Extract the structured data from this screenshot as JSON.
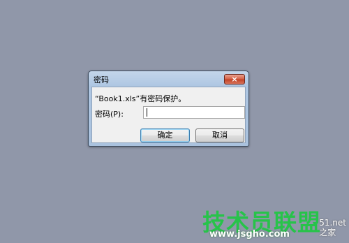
{
  "dialog": {
    "title": "密码",
    "close_symbol": "×",
    "message": "“Book1.xls”有密码保护。",
    "password_label": "密码(P):",
    "password_value": "",
    "ok_label": "确定",
    "cancel_label": "取消"
  },
  "watermark": {
    "brand": "技术员联盟",
    "url": "www.jsgho.com",
    "side_top": "51.net",
    "side_bottom": "之家"
  }
}
